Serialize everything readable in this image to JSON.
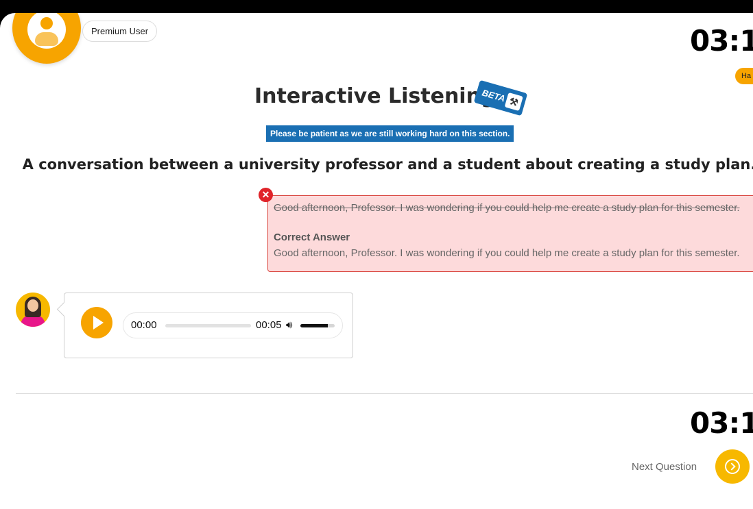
{
  "header": {
    "user_badge": "Premium User",
    "timer": "03:1",
    "tag_label": "Ha"
  },
  "section": {
    "title": "Interactive Listening",
    "beta_label": "BETA",
    "notice": "Please be patient as we are still working hard on this section."
  },
  "question": {
    "prompt": "A conversation between a university professor and a student about creating a study plan."
  },
  "answer": {
    "user_answer": "Good afternoon, Professor. I was wondering if you could help me create a study plan for this semester.",
    "correct_label": "Correct Answer",
    "correct_text": "Good afternoon, Professor. I was wondering if you could help me create a study plan for this semester."
  },
  "audio": {
    "current_time": "00:00",
    "duration": "00:05",
    "progress_fraction": 0,
    "volume_fraction": 0.8
  },
  "footer": {
    "timer": "03:1",
    "next_label": "Next Question"
  },
  "colors": {
    "accent": "#f7a400",
    "beta": "#1a6fb3",
    "error_bg": "#fddadb",
    "error_border": "#d9453e"
  },
  "icons": {
    "user": "user-avatar-icon",
    "error": "close-circle-icon",
    "play": "play-icon",
    "volume": "volume-icon",
    "next": "chevron-right-circle-icon"
  }
}
